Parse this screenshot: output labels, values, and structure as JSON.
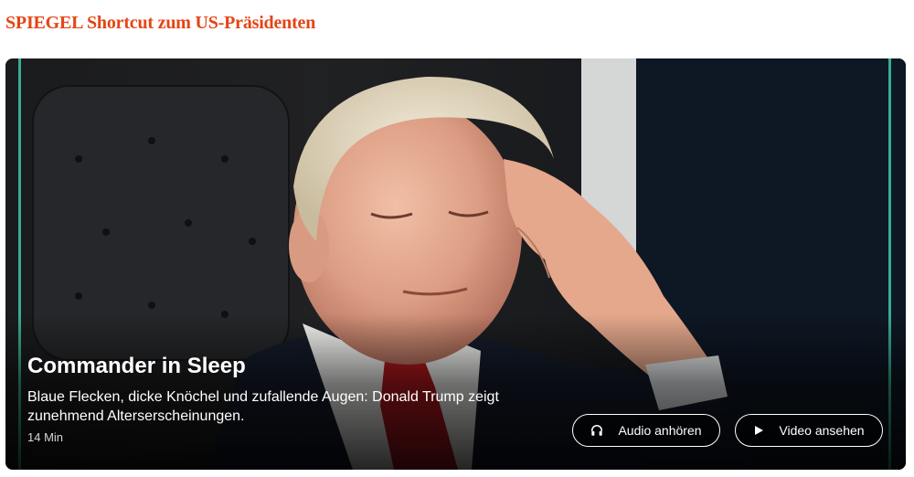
{
  "section": {
    "title": "SPIEGEL Shortcut zum US-Präsidenten"
  },
  "card": {
    "image": {
      "description": "Foto eines älteren Mannes mit geschlossenen Augen, Hand an der Stirn"
    },
    "headline": "Commander in Sleep",
    "teaser": "Blaue Flecken, dicke Knöchel und zufallende Augen: Donald Trump zeigt zunehmend Alterserscheinungen.",
    "duration": "14 Min",
    "buttons": {
      "audio": {
        "label": "Audio anhören",
        "icon": "headphones-icon"
      },
      "video": {
        "label": "Video ansehen",
        "icon": "play-icon"
      }
    }
  },
  "colors": {
    "brand": "#e64415",
    "accent": "#3ec7a4",
    "card_bg": "#0d0f12",
    "text_on_dark": "#ffffff"
  }
}
